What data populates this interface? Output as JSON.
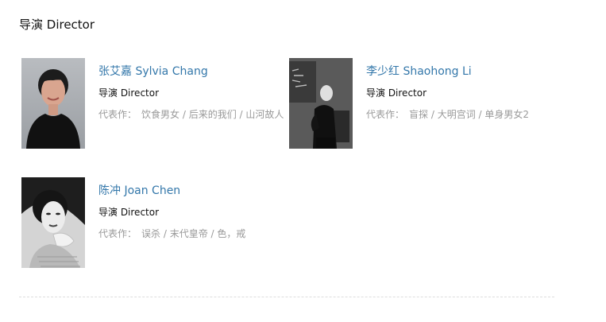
{
  "section": {
    "title": "导演 Director"
  },
  "celebrities": [
    {
      "name": "张艾嘉 Sylvia Chang",
      "role": "导演 Director",
      "works_label": "代表作：",
      "works": "饮食男女 / 后来的我们 / 山河故人"
    },
    {
      "name": "李少红 Shaohong Li",
      "role": "导演 Director",
      "works_label": "代表作：",
      "works": "盲探 / 大明宫词 / 单身男女2"
    },
    {
      "name": "陈冲 Joan Chen",
      "role": "导演 Director",
      "works_label": "代表作：",
      "works": "误杀 / 末代皇帝 / 色，戒"
    }
  ],
  "colors": {
    "link": "#3377aa",
    "muted": "#999999",
    "divider": "#dddddd"
  }
}
